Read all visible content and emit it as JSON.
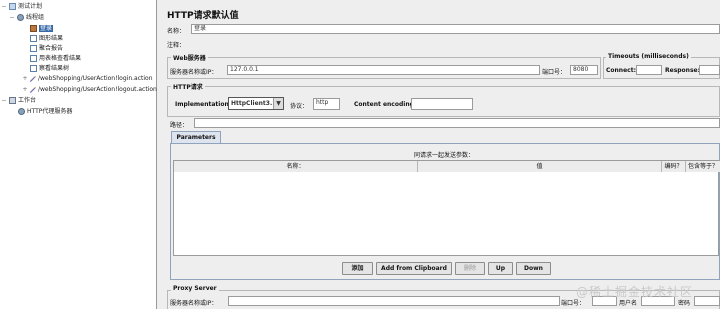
{
  "tree": {
    "test_plan": "测试计划",
    "thread_group": "线程组",
    "selected_item": "登录",
    "items": [
      "图形结果",
      "聚合报告",
      "用表格查看结果",
      "察看结果树",
      "/webShopping/UserAction!login.action",
      "/webShopping/UserAction!logout.action"
    ],
    "workbench": "工作台",
    "proxy": "HTTP代理服务器"
  },
  "panel": {
    "title": "HTTP请求默认值",
    "name_label": "名称：",
    "name_value": "登录",
    "comment_label": "注释：",
    "webserver": {
      "title": "Web服务器",
      "host_label": "服务器名称或IP：",
      "host_value": "127.0.0.1",
      "port_label": "端口号：",
      "port_value": "8080"
    },
    "timeouts": {
      "title": "Timeouts (milliseconds)",
      "connect_label": "Connect:",
      "response_label": "Response:"
    },
    "http_request": {
      "title": "HTTP请求",
      "implementation_label": "Implementation:",
      "implementation_value": "HttpClient3.1",
      "protocol_label": "协议：",
      "protocol_value": "http",
      "encoding_label": "Content encoding:",
      "path_label": "路径："
    },
    "params": {
      "tab": "Parameters",
      "table_title": "同请求一起发送参数：",
      "columns": [
        "名称：",
        "值",
        "编码？",
        "包含等于？"
      ]
    },
    "buttons": {
      "add": "添加",
      "clipboard": "Add from Clipboard",
      "delete": "删除",
      "up": "Up",
      "down": "Down"
    },
    "proxy": {
      "title": "Proxy Server",
      "host_label": "服务器名称或IP：",
      "port_label": "端口号：",
      "user_label": "用户名",
      "password_label": "密码"
    }
  },
  "watermark": "@稀土掘金技术社区"
}
